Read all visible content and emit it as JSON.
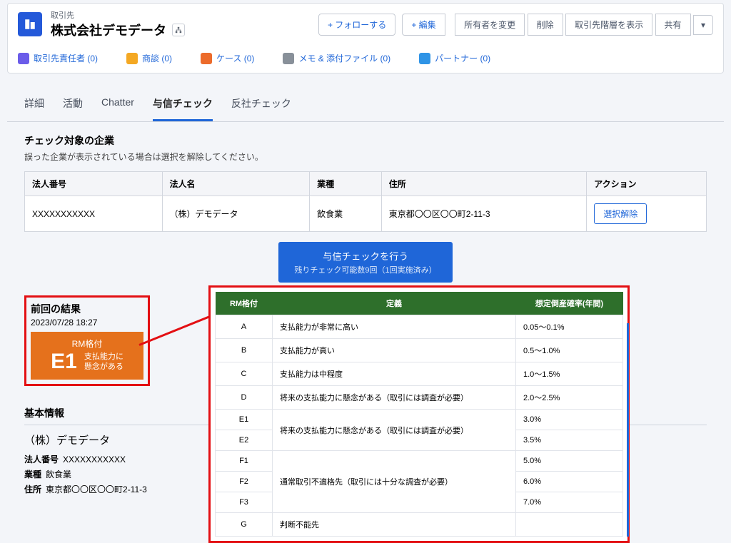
{
  "header": {
    "object_label": "取引先",
    "record_name": "株式会社デモデータ",
    "actions": {
      "follow": "フォローする",
      "edit": "編集",
      "change_owner": "所有者を変更",
      "delete": "削除",
      "hierarchy": "取引先階層を表示",
      "share": "共有"
    }
  },
  "related": {
    "contact": "取引先責任者 (0)",
    "opportunity": "商談 (0)",
    "case": "ケース (0)",
    "note": "メモ & 添付ファイル (0)",
    "partner": "パートナー (0)"
  },
  "tabs": [
    "詳細",
    "活動",
    "Chatter",
    "与信チェック",
    "反社チェック"
  ],
  "section": {
    "title": "チェック対象の企業",
    "sub": "誤った企業が表示されている場合は選択を解除してください。"
  },
  "company_table": {
    "headers": [
      "法人番号",
      "法人名",
      "業種",
      "住所",
      "アクション"
    ],
    "row": {
      "num": "XXXXXXXXXXX",
      "name": "（株）デモデータ",
      "industry": "飲食業",
      "address": "東京都〇〇区〇〇町2-11-3",
      "unselect": "選択解除"
    }
  },
  "run_button": {
    "main": "与信チェックを行う",
    "sub": "残りチェック可能数9回（1回実施済み）"
  },
  "previous": {
    "title": "前回の結果",
    "timestamp": "2023/07/28 18:27",
    "rm_label": "RM格付",
    "grade": "E1",
    "desc1": "支払能力に",
    "desc2": "懸念がある"
  },
  "basic": {
    "title": "基本情報",
    "name": "（株）デモデータ",
    "num_label": "法人番号",
    "num": "XXXXXXXXXXX",
    "industry_label": "業種",
    "industry": "飲食業",
    "address_label": "住所",
    "address": "東京都〇〇区〇〇町2-11-3"
  },
  "rating_table": {
    "headers": [
      "RM格付",
      "定義",
      "想定倒産確率(年間)"
    ],
    "rows": [
      {
        "g": "A",
        "def": "支払能力が非常に高い",
        "p": "0.05～0.1%"
      },
      {
        "g": "B",
        "def": "支払能力が高い",
        "p": "0.5～1.0%"
      },
      {
        "g": "C",
        "def": "支払能力は中程度",
        "p": "1.0～1.5%"
      },
      {
        "g": "D",
        "def": "将来の支払能力に懸念がある（取引には調査が必要）",
        "p": "2.0～2.5%"
      },
      {
        "g": "E1",
        "def": "将来の支払能力に懸念がある（取引には調査が必要）",
        "p": "3.0%",
        "rs": 2
      },
      {
        "g": "E2",
        "p": "3.5%"
      },
      {
        "g": "F1",
        "def": "通常取引不適格先（取引には十分な調査が必要）",
        "p": "5.0%",
        "rs": 3
      },
      {
        "g": "F2",
        "p": "6.0%"
      },
      {
        "g": "F3",
        "p": "7.0%"
      },
      {
        "g": "G",
        "def": "判断不能先",
        "p": ""
      }
    ]
  }
}
